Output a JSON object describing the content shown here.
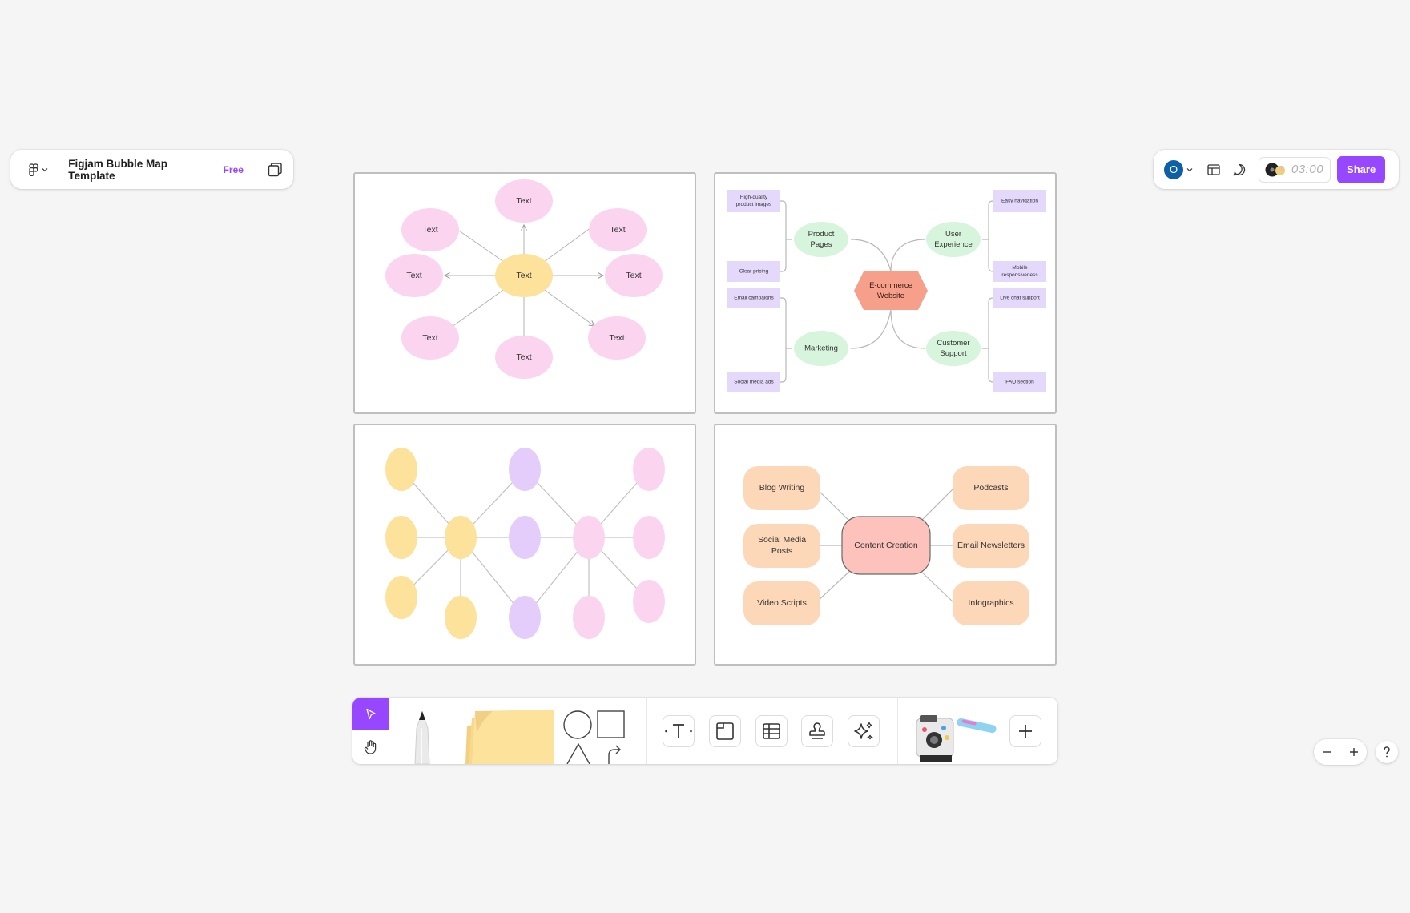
{
  "file": {
    "title": "Figjam Bubble Map Template",
    "badge": "Free"
  },
  "header": {
    "avatar_initial": "O",
    "timer": "03:00",
    "share_label": "Share"
  },
  "board1": {
    "center": "Text",
    "nodes": [
      "Text",
      "Text",
      "Text",
      "Text",
      "Text",
      "Text",
      "Text",
      "Text"
    ]
  },
  "board2": {
    "center": [
      "E-commerce",
      "Website"
    ],
    "product_pages": [
      "Product",
      "Pages"
    ],
    "user_experience": [
      "User",
      "Experience"
    ],
    "marketing": "Marketing",
    "customer_support": [
      "Customer",
      "Support"
    ],
    "notes": {
      "high_quality": [
        "High-quality",
        "product images"
      ],
      "clear_pricing": "Clear pricing",
      "email_campaigns": "Email campaigns",
      "social_media_ads": "Social media ads",
      "easy_navigation": "Easy navigation",
      "mobile": [
        "Mobile",
        "responsiveness"
      ],
      "live_chat": "Live chat support",
      "faq": "FAQ section"
    }
  },
  "board4": {
    "center": "Content Creation",
    "blog": "Blog Writing",
    "social": [
      "Social Media",
      "Posts"
    ],
    "video": "Video Scripts",
    "podcasts": "Podcasts",
    "newsletters": "Email Newsletters",
    "infographics": "Infographics"
  },
  "colors": {
    "accent": "#9747ff",
    "pink": "#fbd5ef",
    "yellow": "#fde29b",
    "purple": "#e4cdfb",
    "green": "#d7f4dc",
    "salmon": "#f6a08c",
    "peach": "#fdd8b8",
    "coral": "#fdc2bb"
  }
}
